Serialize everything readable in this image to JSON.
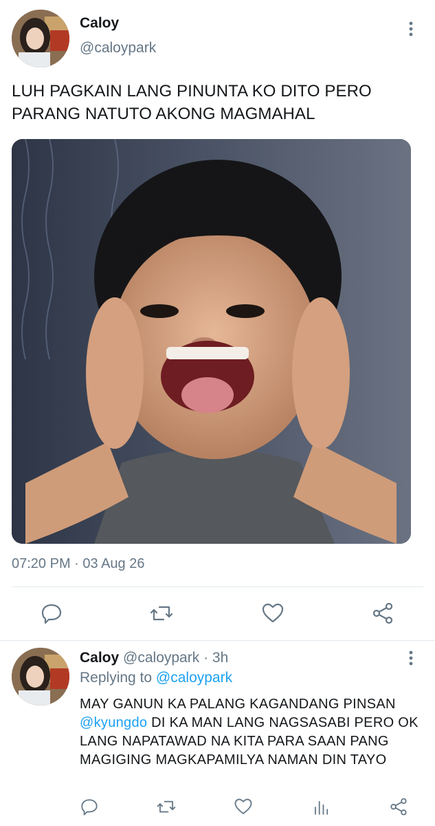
{
  "tweet": {
    "author_name": "Caloy",
    "author_handle": "@caloypark",
    "text": "LUH PAGKAIN LANG PINUNTA KO DITO PERO PARANG NATUTO AKONG MAGMAHAL",
    "timestamp": "07:20 PM · 03 Aug 26",
    "media_icon": "photo-reaction-kid-screaming"
  },
  "actions": [
    {
      "icon": "reply-icon"
    },
    {
      "icon": "retweet-icon"
    },
    {
      "icon": "like-icon"
    },
    {
      "icon": "share-icon"
    }
  ],
  "reply": {
    "author_name": "Caloy",
    "author_handle": "@caloypark",
    "time_ago": "3h",
    "replying_prefix": "Replying to",
    "replying_to": "@caloypark",
    "text_part1": "MAY GANUN KA PALANG KAGANDANG PINSAN",
    "mention": "@kyungdo",
    "text_part2": " DI KA MAN LANG NAGSASABI PERO OK LANG NAPATAWAD NA KITA PARA SAAN PANG MAGIGING MAGKAPAMILYA NAMAN DIN TAYO"
  },
  "colors": {
    "link": "#1da1f2",
    "secondary_text": "#657786",
    "divider": "#e1e8ed"
  }
}
